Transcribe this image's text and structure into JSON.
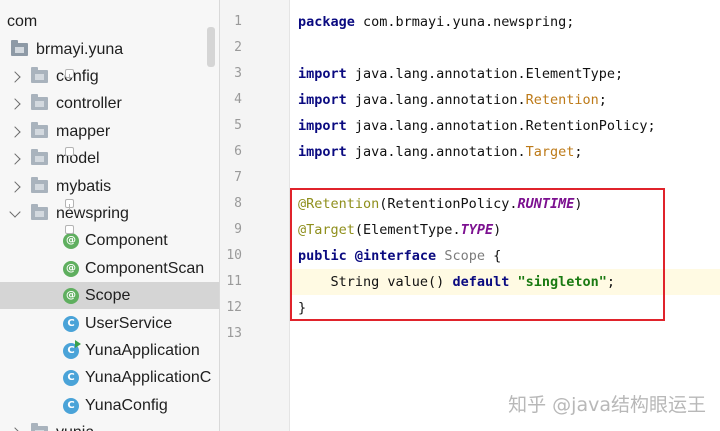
{
  "project_tree": {
    "items": [
      {
        "label": "com"
      },
      {
        "label": "brmayi.yuna"
      },
      {
        "label": "config"
      },
      {
        "label": "controller"
      },
      {
        "label": "mapper"
      },
      {
        "label": "model"
      },
      {
        "label": "mybatis"
      },
      {
        "label": "newspring"
      },
      {
        "label": "Component"
      },
      {
        "label": "ComponentScan"
      },
      {
        "label": "Scope"
      },
      {
        "label": "UserService"
      },
      {
        "label": "YunaApplication"
      },
      {
        "label": "YunaApplicationC"
      },
      {
        "label": "YunaConfig"
      },
      {
        "label": "yunia"
      }
    ],
    "selected": "Scope",
    "icon_glyphs": {
      "annotation": "@",
      "class": "C"
    }
  },
  "editor": {
    "line_numbers": [
      "1",
      "2",
      "3",
      "4",
      "5",
      "6",
      "7",
      "8",
      "9",
      "10",
      "11",
      "12",
      "13"
    ],
    "code": {
      "l1": {
        "kw": "package",
        "rest": " com.brmayi.yuna.newspring;"
      },
      "l3": {
        "kw": "import",
        "pre": " java.lang.annotation.",
        "name": "ElementType",
        "post": ";"
      },
      "l4": {
        "kw": "import",
        "pre": " java.lang.annotation.",
        "name": "Retention",
        "post": ";"
      },
      "l5": {
        "kw": "import",
        "pre": " java.lang.annotation.",
        "name": "RetentionPolicy",
        "post": ";"
      },
      "l6": {
        "kw": "import",
        "pre": " java.lang.annotation.",
        "name": "Target",
        "post": ";"
      },
      "l8": {
        "ann": "@Retention",
        "open": "(RetentionPolicy.",
        "const": "RUNTIME",
        "close": ")"
      },
      "l9": {
        "ann": "@Target",
        "open": "(ElementType.",
        "const": "TYPE",
        "close": ")"
      },
      "l10": {
        "kw1": "public",
        "kw2": " @interface",
        "name": " Scope",
        "post": " {"
      },
      "l11": {
        "pre": "    String value() ",
        "kw": "default",
        "sp": " ",
        "str": "\"singleton\"",
        "post": ";"
      },
      "l12": {
        "text": "}"
      }
    },
    "current_line": "11",
    "highlight_color": "#e0232b"
  },
  "watermark": "知乎 @java结构眼运王"
}
